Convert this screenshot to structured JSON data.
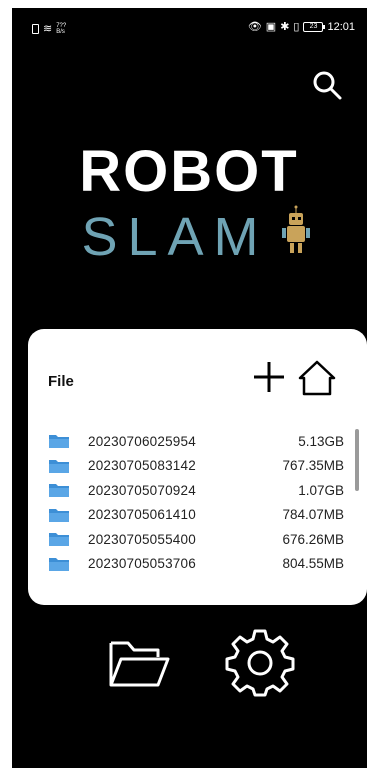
{
  "status_bar": {
    "network_speed": "7?? B/s",
    "time": "12:01",
    "battery": "23"
  },
  "logo": {
    "line1": "ROBOT",
    "line2": "SLAM"
  },
  "file_panel": {
    "title": "File",
    "files": [
      {
        "name": "20230706025954",
        "size": "5.13GB"
      },
      {
        "name": "20230705083142",
        "size": "767.35MB"
      },
      {
        "name": "20230705070924",
        "size": "1.07GB"
      },
      {
        "name": "20230705061410",
        "size": "784.07MB"
      },
      {
        "name": "20230705055400",
        "size": "676.26MB"
      },
      {
        "name": "20230705053706",
        "size": "804.55MB"
      }
    ]
  },
  "colors": {
    "background": "#000000",
    "card": "#ffffff",
    "logo_white": "#ffffff",
    "logo_teal": "#6fa3b4",
    "folder_blue": "#3d8fd6",
    "robot_gold": "#c9a35a"
  },
  "icons": {
    "search": "search-icon",
    "add": "plus-icon",
    "home": "home-icon",
    "folder": "folder-icon",
    "settings": "gear-icon"
  }
}
